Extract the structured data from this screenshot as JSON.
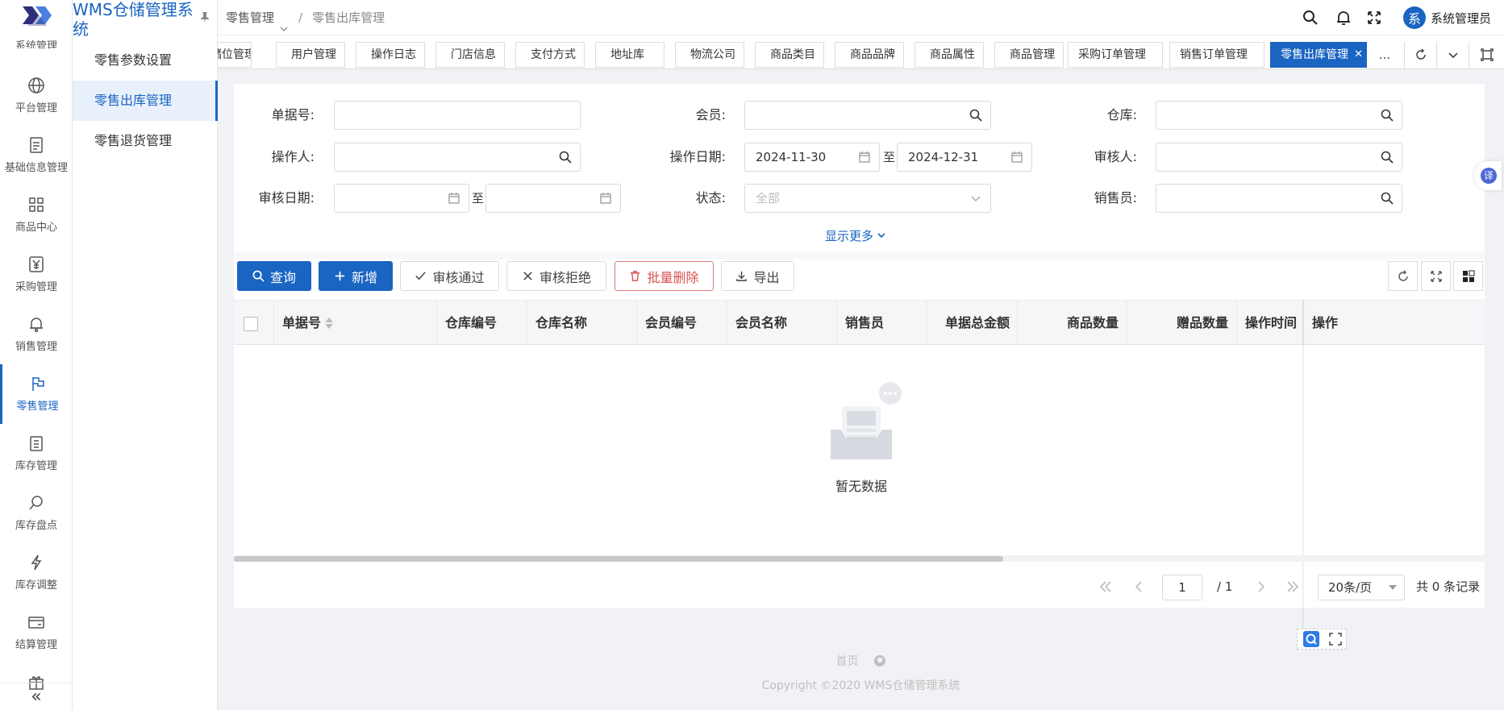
{
  "app": {
    "title": "WMS仓储管理系统"
  },
  "rail": {
    "cut_label": "系统管理",
    "items": [
      {
        "label": "平台管理",
        "icon": "globe-icon"
      },
      {
        "label": "基础信息管理",
        "icon": "document-icon"
      },
      {
        "label": "商品中心",
        "icon": "grid-icon"
      },
      {
        "label": "采购管理",
        "icon": "yen-icon"
      },
      {
        "label": "销售管理",
        "icon": "bell-icon"
      },
      {
        "label": "零售管理",
        "icon": "flag-icon",
        "active": true
      },
      {
        "label": "库存管理",
        "icon": "clipboard-icon"
      },
      {
        "label": "库存盘点",
        "icon": "search-doc-icon"
      },
      {
        "label": "库存调整",
        "icon": "lightning-icon"
      },
      {
        "label": "结算管理",
        "icon": "card-icon"
      },
      {
        "label": "",
        "icon": "gift-icon"
      }
    ],
    "collapse": "«"
  },
  "submenu": {
    "items": [
      {
        "label": "零售参数设置"
      },
      {
        "label": "零售出库管理",
        "active": true
      },
      {
        "label": "零售退货管理"
      }
    ]
  },
  "header": {
    "breadcrumb_parent": "零售管理",
    "breadcrumb_sep": "/",
    "breadcrumb_current": "零售出库管理",
    "user_name": "系统管理员",
    "avatar_text": "系"
  },
  "tabs": [
    {
      "label": "储位管理"
    },
    {
      "label": "用户管理"
    },
    {
      "label": "操作日志"
    },
    {
      "label": "门店信息"
    },
    {
      "label": "支付方式"
    },
    {
      "label": "地址库"
    },
    {
      "label": "物流公司"
    },
    {
      "label": "商品类目"
    },
    {
      "label": "商品品牌"
    },
    {
      "label": "商品属性"
    },
    {
      "label": "商品管理"
    },
    {
      "label": "采购订单管理"
    },
    {
      "label": "销售订单管理"
    },
    {
      "label": "零售出库管理",
      "active": true
    }
  ],
  "tabs_more": "...",
  "filters": {
    "doc_no": {
      "label": "单据号:",
      "value": ""
    },
    "member": {
      "label": "会员:",
      "value": ""
    },
    "warehouse": {
      "label": "仓库:",
      "value": ""
    },
    "operator": {
      "label": "操作人:",
      "value": ""
    },
    "op_date": {
      "label": "操作日期:",
      "start": "2024-11-30",
      "end": "2024-12-31",
      "to": "至"
    },
    "auditor": {
      "label": "审核人:",
      "value": ""
    },
    "audit_date": {
      "label": "审核日期:",
      "start": "",
      "end": "",
      "to": "至"
    },
    "status": {
      "label": "状态:",
      "placeholder": "全部"
    },
    "salesperson": {
      "label": "销售员:",
      "value": ""
    },
    "show_more": "显示更多"
  },
  "toolbar": {
    "query": "查询",
    "add": "新增",
    "approve": "审核通过",
    "reject": "审核拒绝",
    "batch_delete": "批量删除",
    "export": "导出"
  },
  "table": {
    "columns": [
      "单据号",
      "仓库编号",
      "仓库名称",
      "会员编号",
      "会员名称",
      "销售员",
      "单据总金额",
      "商品数量",
      "赠品数量",
      "操作时间",
      "操作"
    ],
    "rows": [],
    "empty_text": "暂无数据"
  },
  "pager": {
    "page": "1",
    "total_pages": "/ 1",
    "page_size": "20条/页",
    "total": "共 0 条记录"
  },
  "footer": {
    "home": "首页",
    "copyright": "Copyright ©2020 WMS仓储管理系统"
  },
  "translate_badge": "译",
  "colors": {
    "primary": "#1a64c2",
    "danger": "#d9534f",
    "background": "#f0f2f5"
  }
}
